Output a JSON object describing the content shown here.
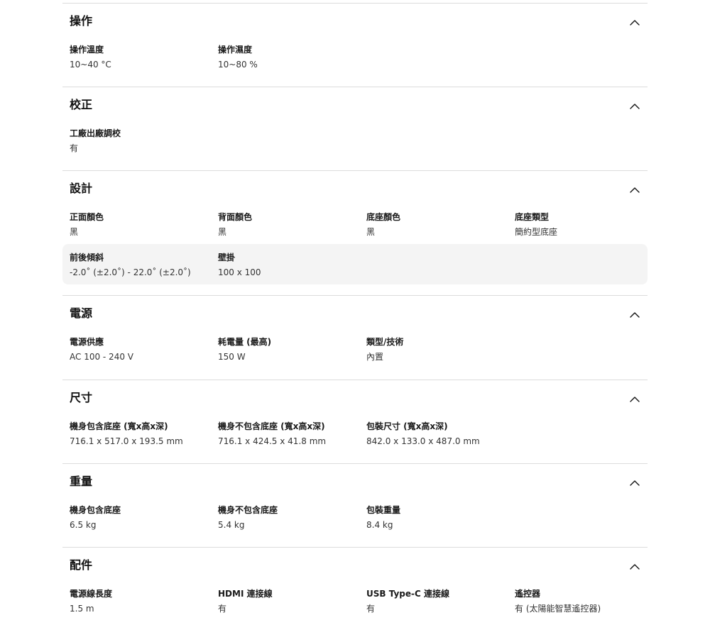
{
  "toggle_icon": "chevron-up-icon",
  "sections": [
    {
      "id": "operation",
      "title": "操作",
      "rows": [
        [
          {
            "label": "操作溫度",
            "value": "10~40 °C"
          },
          {
            "label": "操作濕度",
            "value": "10~80 %"
          }
        ]
      ]
    },
    {
      "id": "calibration",
      "title": "校正",
      "rows": [
        [
          {
            "label": "工廠出廠調校",
            "value": "有"
          }
        ]
      ]
    },
    {
      "id": "design",
      "title": "設計",
      "rows": [
        [
          {
            "label": "正面顏色",
            "value": "黑"
          },
          {
            "label": "背面顏色",
            "value": "黑"
          },
          {
            "label": "底座顏色",
            "value": "黑"
          },
          {
            "label": "底座類型",
            "value": "簡約型底座"
          }
        ],
        [
          {
            "label": "前後傾斜",
            "value": "-2.0˚ (±2.0˚) - 22.0˚ (±2.0˚)"
          },
          {
            "label": "壁掛",
            "value": "100 x 100"
          }
        ]
      ]
    },
    {
      "id": "power",
      "title": "電源",
      "rows": [
        [
          {
            "label": "電源供應",
            "value": "AC 100 - 240 V"
          },
          {
            "label": "耗電量 (最高)",
            "value": "150 W"
          },
          {
            "label": "類型/技術",
            "value": "內置"
          }
        ]
      ]
    },
    {
      "id": "dimensions",
      "title": "尺寸",
      "rows": [
        [
          {
            "label": "機身包含底座 (寬x高x深)",
            "value": "716.1 x 517.0 x 193.5 mm"
          },
          {
            "label": "機身不包含底座 (寬x高x深)",
            "value": "716.1 x 424.5 x 41.8 mm"
          },
          {
            "label": "包裝尺寸 (寬x高x深)",
            "value": "842.0 x 133.0 x 487.0 mm"
          }
        ]
      ]
    },
    {
      "id": "weight",
      "title": "重量",
      "rows": [
        [
          {
            "label": "機身包含底座",
            "value": "6.5 kg"
          },
          {
            "label": "機身不包含底座",
            "value": "5.4 kg"
          },
          {
            "label": "包裝重量",
            "value": "8.4 kg"
          }
        ]
      ]
    },
    {
      "id": "accessories",
      "title": "配件",
      "rows": [
        [
          {
            "label": "電源線長度",
            "value": "1.5 m"
          },
          {
            "label": "HDMI 連接線",
            "value": "有"
          },
          {
            "label": "USB Type-C 連接線",
            "value": "有"
          },
          {
            "label": "遙控器",
            "value": "有 (太陽能智慧遙控器)"
          }
        ]
      ]
    }
  ]
}
